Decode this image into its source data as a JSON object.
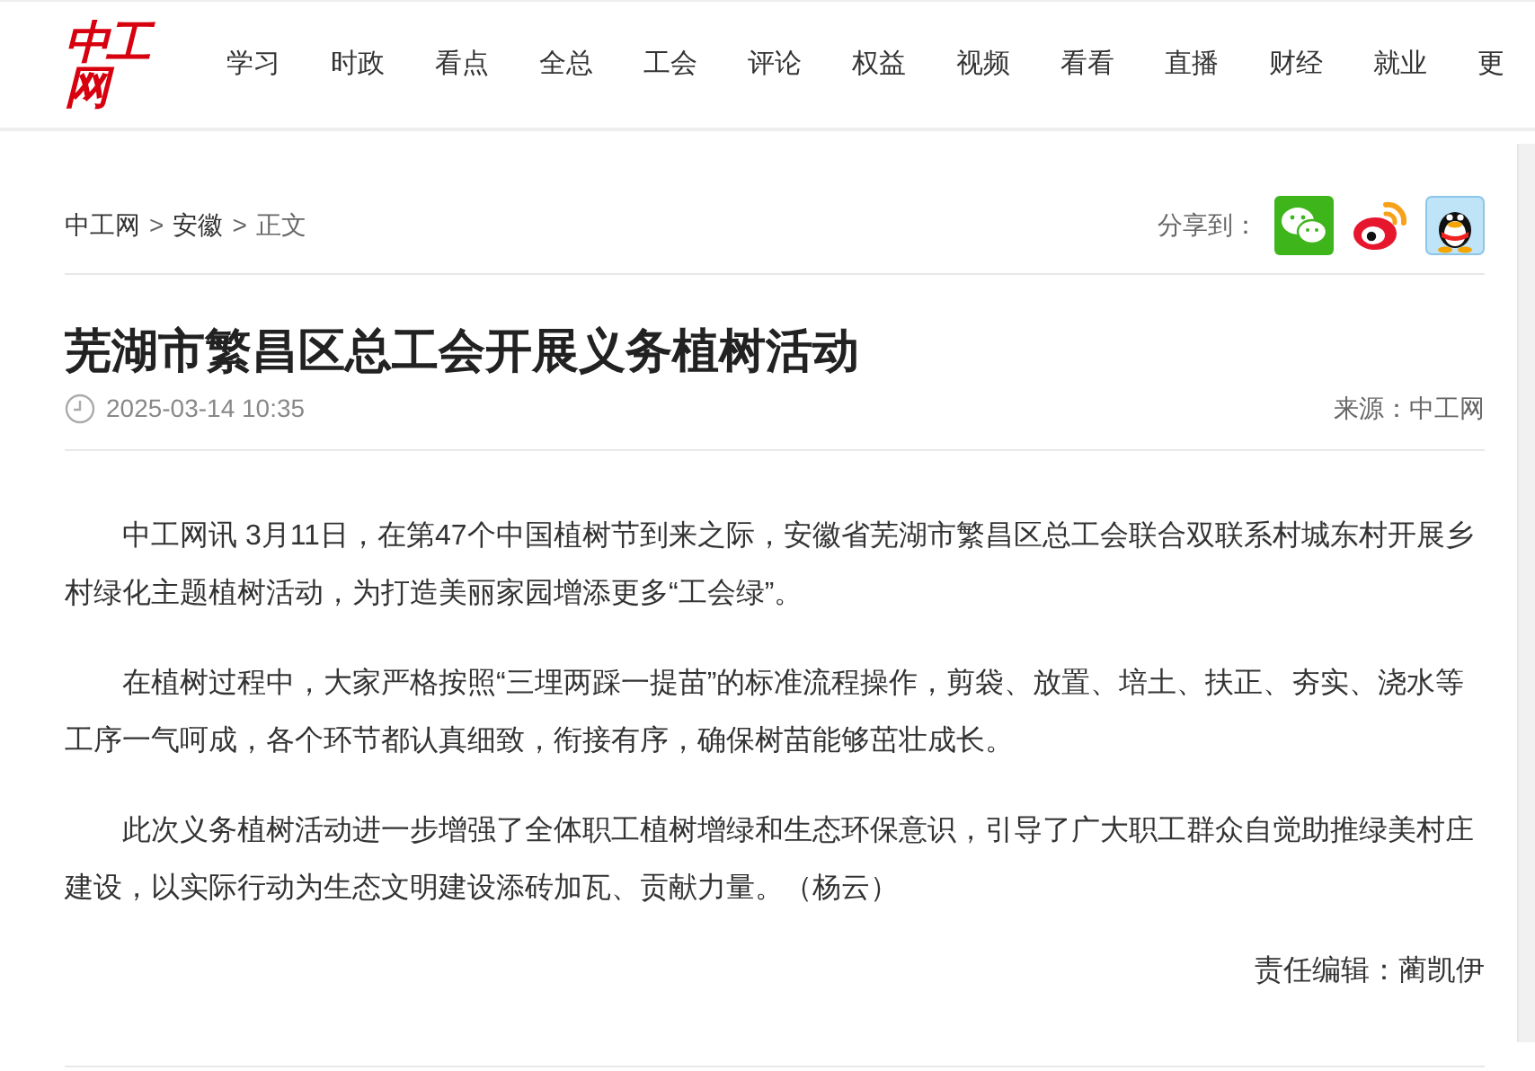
{
  "logo": "中工网",
  "nav": [
    {
      "label": "学习"
    },
    {
      "label": "时政"
    },
    {
      "label": "看点"
    },
    {
      "label": "全总"
    },
    {
      "label": "工会"
    },
    {
      "label": "评论"
    },
    {
      "label": "权益"
    },
    {
      "label": "视频"
    },
    {
      "label": "看看"
    },
    {
      "label": "直播"
    },
    {
      "label": "财经"
    },
    {
      "label": "就业"
    },
    {
      "label": "更"
    }
  ],
  "breadcrumb": [
    "中工网",
    "安徽",
    "正文"
  ],
  "breadcrumb_separator": ">",
  "share": {
    "label": "分享到：",
    "targets": [
      {
        "kind": "wechat"
      },
      {
        "kind": "weibo"
      },
      {
        "kind": "qq"
      }
    ]
  },
  "article": {
    "title": "芜湖市繁昌区总工会开展义务植树活动",
    "time": "2025-03-14 10:35",
    "source": "来源：中工网",
    "paragraphs": [
      "中工网讯 3月11日，在第47个中国植树节到来之际，安徽省芜湖市繁昌区总工会联合双联系村城东村开展乡村绿化主题植树活动，为打造美丽家园增添更多“工会绿”。",
      "在植树过程中，大家严格按照“三埋两踩一提苗”的标准流程操作，剪袋、放置、培土、扶正、夯实、浇水等工序一气呵成，各个环节都认真细致，衔接有序，确保树苗能够茁壮成长。",
      "此次义务植树活动进一步增强了全体职工植树增绿和生态环保意识，引导了广大职工群众自觉助推绿美村庄建设，以实际行动为生态文明建设添砖加瓦、贡献力量。（杨云）"
    ],
    "editor": "责任编辑：蔺凯伊"
  }
}
